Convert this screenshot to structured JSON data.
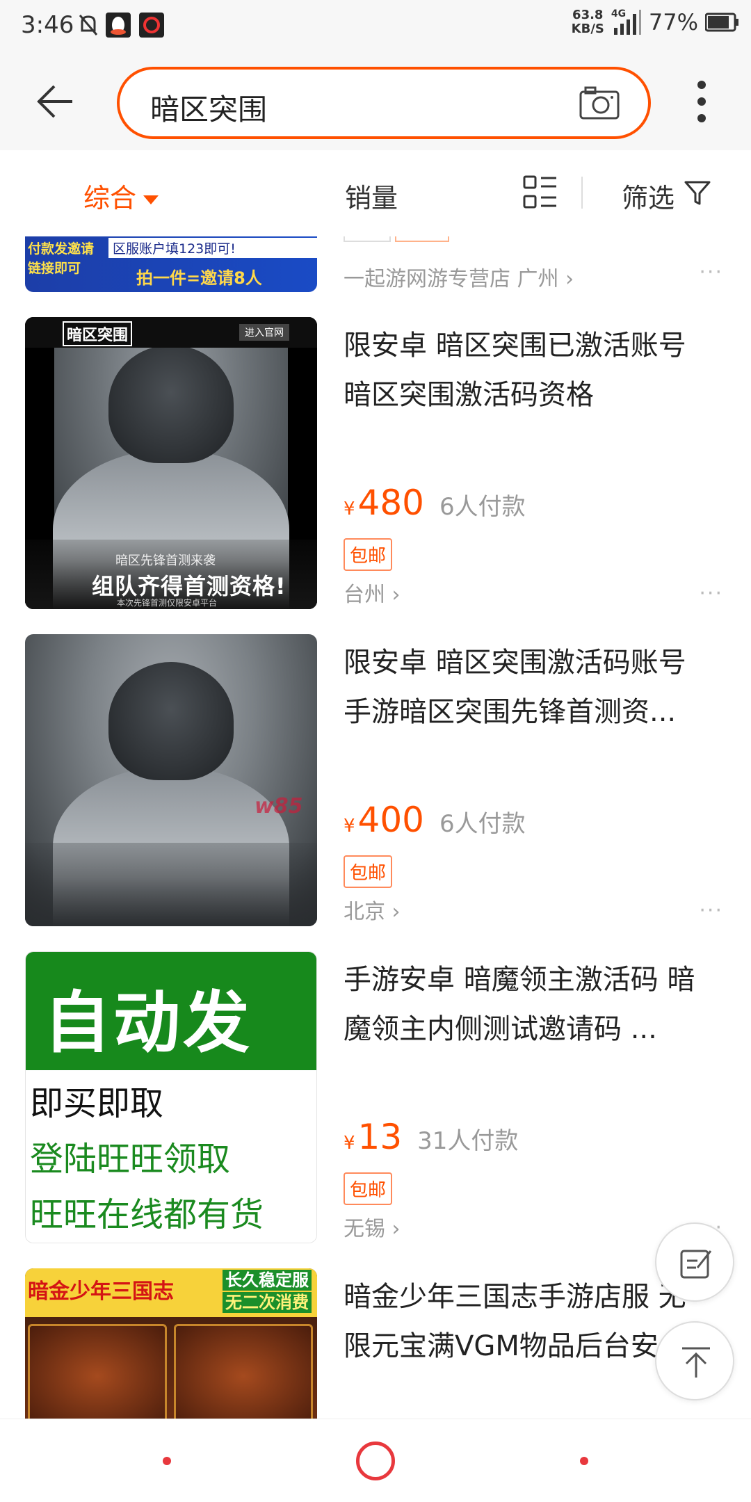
{
  "status_bar": {
    "time": "3:46",
    "net_speed_value": "63.8",
    "net_speed_unit": "KB/S",
    "network": "4G",
    "battery": "77%"
  },
  "search": {
    "query": "暗区突围"
  },
  "filters": {
    "comprehensive": "综合",
    "sales": "销量",
    "filter": "筛选"
  },
  "top_partial": {
    "banner_line1": "付款发邀请",
    "banner_line2": "链接即可",
    "banner_note": "区服账户填123即可!",
    "banner_promo": "拍一件=邀请8人",
    "shop": "一起游网游专营店 广州 ›"
  },
  "products": [
    {
      "title": "限安卓 暗区突围已激活账号 暗区突围激活码资格",
      "currency": "¥",
      "price": "480",
      "sales": "6人付款",
      "badge": "包邮",
      "location": "台州 ›",
      "img_logo": "暗区突围",
      "img_button": "进入官网",
      "img_line1": "暗区先锋首测来袭",
      "img_line2": "组队齐得首测资格!",
      "img_line3": "本次先锋首测仅限安卓平台"
    },
    {
      "title": "限安卓 暗区突围激活码账号 手游暗区突围先锋首测资...",
      "currency": "¥",
      "price": "400",
      "sales": "6人付款",
      "badge": "包邮",
      "location": "北京 ›",
      "img_watermark": "w85"
    },
    {
      "title": "手游安卓 暗魔领主激活码 暗魔领主内侧测试邀请码 ...",
      "currency": "¥",
      "price": "13",
      "sales": "31人付款",
      "badge": "包邮",
      "location": "无锡 ›",
      "img_title": "自动发卡",
      "img_line1": "即买即取",
      "img_line2": "登陆旺旺领取",
      "img_line3": "旺旺在线都有货"
    },
    {
      "title": "暗金少年三国志手游店服 无限元宝满VGM物品后台安...",
      "img_title": "暗金少年三国志",
      "img_tag1": "长久稳定服",
      "img_tag2": "无二次消费"
    }
  ],
  "more_dots": "···",
  "colors": {
    "accent": "#ff5000",
    "nav_red": "#e8383d"
  }
}
